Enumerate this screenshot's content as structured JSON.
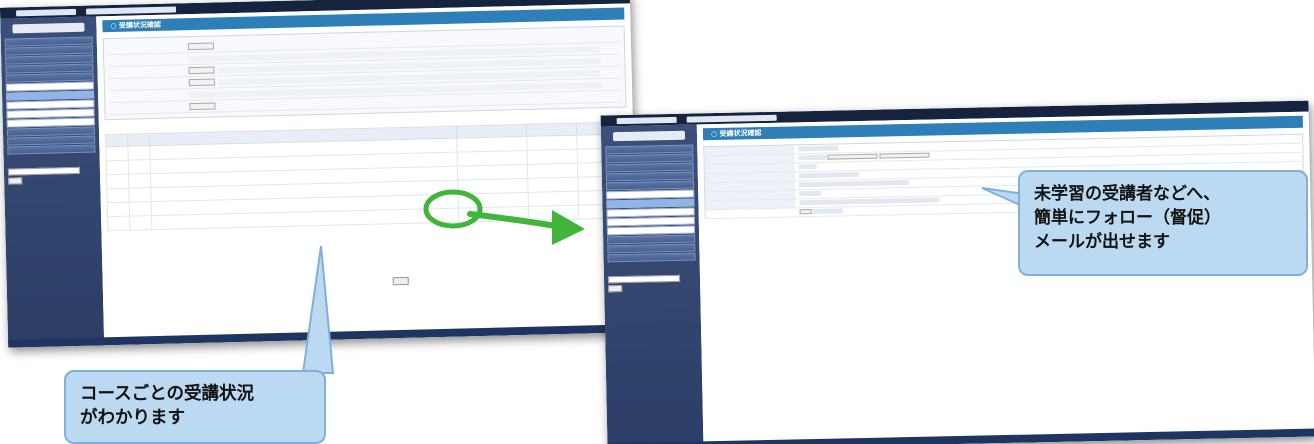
{
  "callouts": {
    "course_status": {
      "line1": "コースごとの受講状況",
      "line2": "がわかります"
    },
    "followup_mail": {
      "line1": "未学習の受講者などへ、",
      "line2": "簡単にフォロー（督促）",
      "line3": "メールが出せます"
    }
  },
  "colors": {
    "callout_fill": "#bcd9f2",
    "callout_border": "#7fb0dc",
    "highlight_green": "#3fb53a",
    "title_bar_blue": "#2e7fb8",
    "header_navy": "#15233f"
  },
  "screen_left": {
    "title": "受講状況確認",
    "menu_items": [
      "",
      "",
      "",
      "",
      "",
      "",
      "",
      "",
      "",
      "",
      "",
      "",
      "",
      "",
      "",
      "",
      ""
    ],
    "table_rows": 6
  },
  "screen_right": {
    "title": "受講状況確認",
    "detail_rows": 8
  }
}
